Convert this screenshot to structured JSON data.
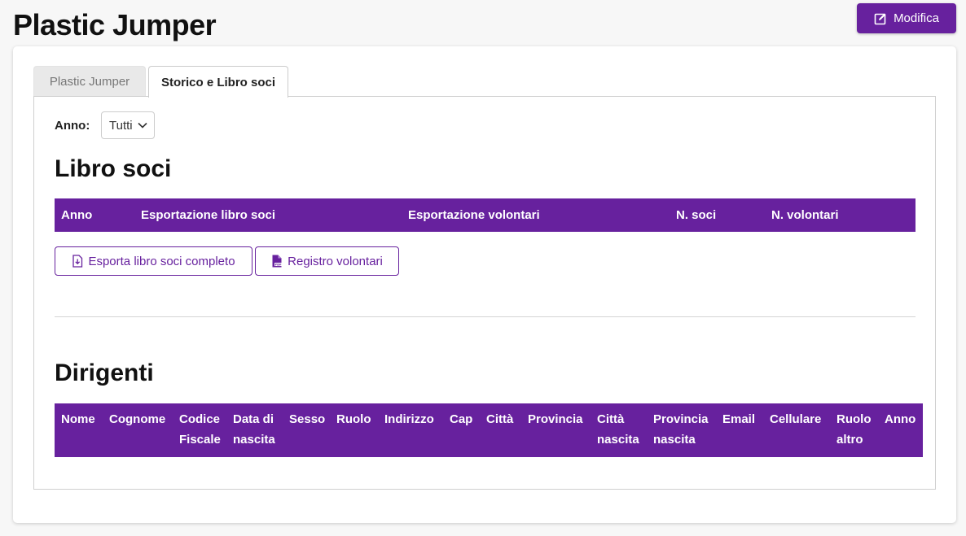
{
  "page": {
    "title": "Plastic Jumper"
  },
  "toolbar": {
    "edit_label": "Modifica"
  },
  "tabs": [
    {
      "label": "Plastic Jumper",
      "active": false
    },
    {
      "label": "Storico e Libro soci",
      "active": true
    }
  ],
  "filter": {
    "label": "Anno:",
    "value": "Tutti"
  },
  "libro_soci": {
    "title": "Libro soci",
    "columns": [
      "Anno",
      "Esportazione libro soci",
      "Esportazione volontari",
      "N. soci",
      "N. volontari"
    ],
    "export_full_label": "Esporta libro soci completo",
    "registry_label": "Registro volontari"
  },
  "dirigenti": {
    "title": "Dirigenti",
    "columns": [
      [
        "Nome"
      ],
      [
        "Cognome"
      ],
      [
        "Codice",
        "Fiscale"
      ],
      [
        "Data di",
        "nascita"
      ],
      [
        "Sesso"
      ],
      [
        "Ruolo"
      ],
      [
        "Indirizzo"
      ],
      [
        "Cap"
      ],
      [
        "Città"
      ],
      [
        "Provincia"
      ],
      [
        "Città",
        "nascita"
      ],
      [
        "Provincia",
        "nascita"
      ],
      [
        "Email"
      ],
      [
        "Cellulare"
      ],
      [
        "Ruolo",
        "altro"
      ],
      [
        "Anno"
      ]
    ]
  },
  "colors": {
    "accent": "#67219e",
    "background": "#f7f7f7",
    "card": "#ffffff"
  }
}
